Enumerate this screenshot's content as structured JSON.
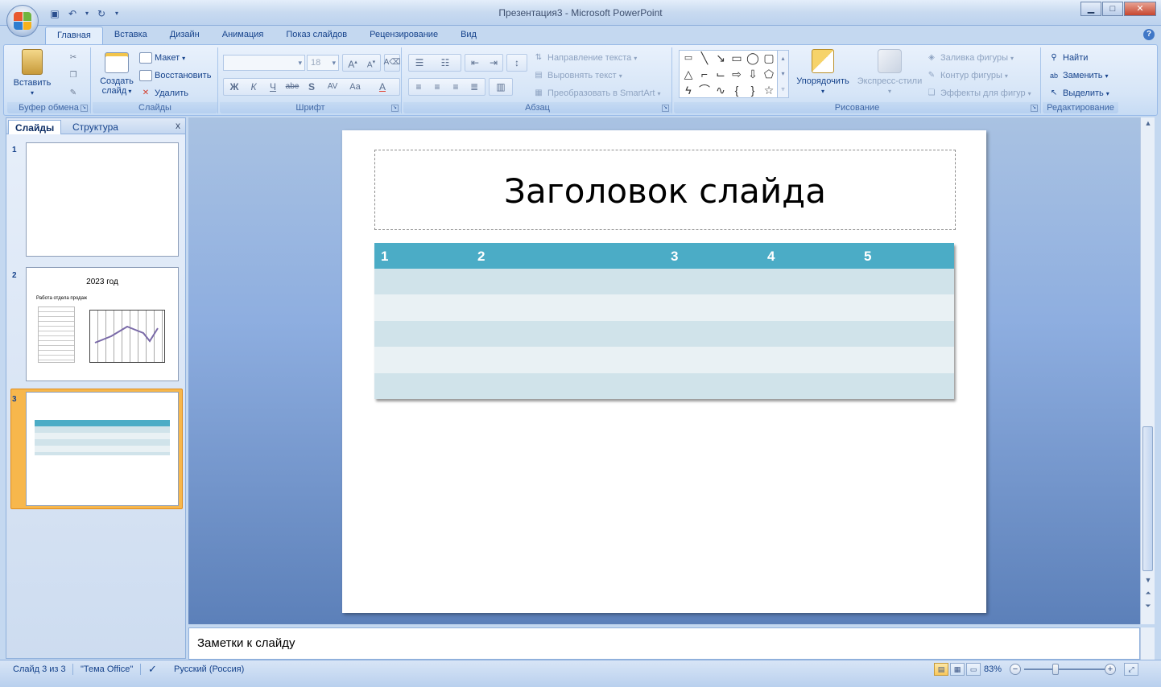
{
  "window": {
    "title": "Презентация3 - Microsoft PowerPoint",
    "controls": {
      "minimize": "▁",
      "maximize": "□",
      "close": "✕"
    }
  },
  "qat": {
    "save_icon": "save-icon",
    "undo_icon": "undo-icon",
    "redo_icon": "redo-icon"
  },
  "tabs": [
    "Главная",
    "Вставка",
    "Дизайн",
    "Анимация",
    "Показ слайдов",
    "Рецензирование",
    "Вид"
  ],
  "help": "?",
  "ribbon": {
    "clipboard": {
      "label": "Буфер обмена",
      "paste": "Вставить"
    },
    "slides": {
      "label": "Слайды",
      "new_slide_line1": "Создать",
      "new_slide_line2": "слайд",
      "layout": "Макет",
      "reset": "Восстановить",
      "delete": "Удалить"
    },
    "font": {
      "label": "Шрифт",
      "font_name": "",
      "font_size": "18",
      "bold": "Ж",
      "italic": "К",
      "underline": "Ч",
      "strike": "abe",
      "shadow": "S",
      "spacing": "AV",
      "case": "Aa",
      "color": "A",
      "grow": "A",
      "shrink": "A"
    },
    "paragraph": {
      "label": "Абзац",
      "text_direction": "Направление текста",
      "align_text": "Выровнять текст",
      "smartart": "Преобразовать в SmartArt"
    },
    "drawing": {
      "label": "Рисование",
      "arrange": "Упорядочить",
      "quick_styles": "Экспресс-стили",
      "shape_fill": "Заливка фигуры",
      "shape_outline": "Контур фигуры",
      "shape_effects": "Эффекты для фигур"
    },
    "editing": {
      "label": "Редактирование",
      "find": "Найти",
      "replace": "Заменить",
      "select": "Выделить"
    }
  },
  "slides_panel": {
    "tab_slides": "Слайды",
    "tab_outline": "Структура",
    "close": "x",
    "thumbs": [
      {
        "num": "1"
      },
      {
        "num": "2",
        "title": "2023 год",
        "subtitle": "Работа отдела продаж"
      },
      {
        "num": "3"
      }
    ]
  },
  "slide": {
    "title": "Заголовок слайда",
    "table_headers": [
      "1",
      "2",
      "3",
      "4",
      "5"
    ],
    "colors": {
      "header": "#4bacc6",
      "band_dark": "#d0e3ea",
      "band_light": "#e9f1f4"
    }
  },
  "notes": {
    "text": "Заметки к слайду"
  },
  "status": {
    "slide_info": "Слайд 3 из 3",
    "theme": "\"Тема Office\"",
    "language": "Русский (Россия)",
    "zoom": "83%"
  }
}
